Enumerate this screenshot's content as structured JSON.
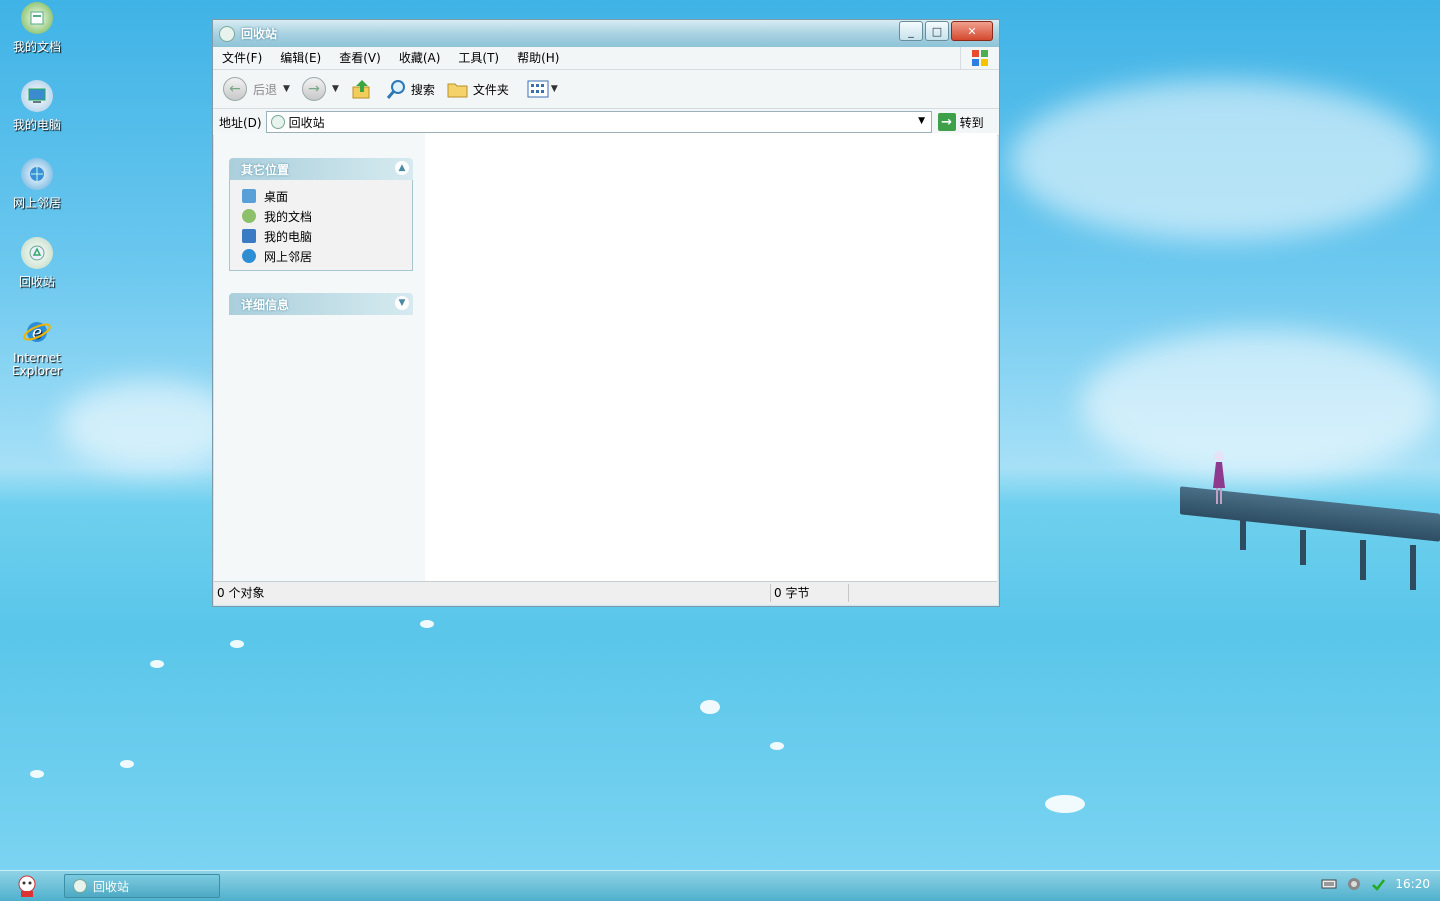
{
  "desktop": {
    "icons": [
      {
        "label": "我的文档"
      },
      {
        "label": "我的电脑"
      },
      {
        "label": "网上邻居"
      },
      {
        "label": "回收站"
      },
      {
        "label": "Internet\nExplorer"
      }
    ]
  },
  "window": {
    "title": "回收站",
    "menu": [
      "文件(F)",
      "编辑(E)",
      "查看(V)",
      "收藏(A)",
      "工具(T)",
      "帮助(H)"
    ],
    "toolbar": {
      "back": "后退",
      "search": "搜索",
      "folders": "文件夹"
    },
    "address": {
      "label": "地址(D)",
      "value": "回收站",
      "go": "转到"
    },
    "panels": {
      "other_places": {
        "title": "其它位置",
        "items": [
          "桌面",
          "我的文档",
          "我的电脑",
          "网上邻居"
        ]
      },
      "details": {
        "title": "详细信息"
      }
    },
    "status": {
      "objects": "0 个对象",
      "size": "0 字节"
    }
  },
  "taskbar": {
    "task_label": "回收站",
    "clock": "16:20"
  },
  "colors": {
    "accent": "#8ec3d7",
    "taskbar": "#4fb0cc"
  }
}
